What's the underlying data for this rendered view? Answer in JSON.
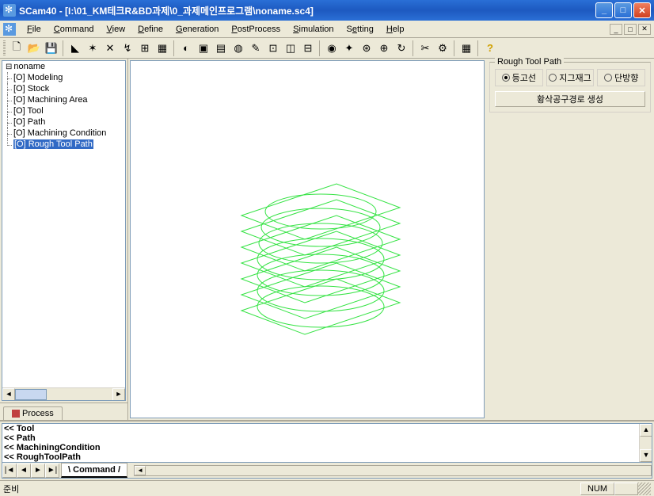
{
  "title": "SCam40 - [I:\\01_KM테크R&BD과제\\0_과제메인프로그램\\noname.sc4]",
  "menu": {
    "file": "File",
    "command": "Command",
    "view": "View",
    "define": "Define",
    "generation": "Generation",
    "postprocess": "PostProcess",
    "simulation": "Simulation",
    "setting": "Setting",
    "help": "Help"
  },
  "tree": {
    "root": "noname",
    "items": [
      "[O] Modeling",
      "[O] Stock",
      "[O] Machining Area",
      "[O] Tool",
      "[O] Path",
      "[O] Machining Condition",
      "[O] Rough Tool Path"
    ],
    "selected_index": 6
  },
  "process_tab": "Process",
  "rightpanel": {
    "legend": "Rough Tool Path",
    "radio1": "등고선",
    "radio2": "지그재그",
    "radio3": "단방향",
    "selected_radio": 0,
    "button": "황삭공구경로 생성"
  },
  "log": {
    "lines": [
      "<< Tool",
      "<< Path",
      "<< MachiningCondition",
      "<< RoughToolPath"
    ]
  },
  "command_tab": "Command",
  "status": {
    "left": "준비",
    "num": "NUM"
  }
}
